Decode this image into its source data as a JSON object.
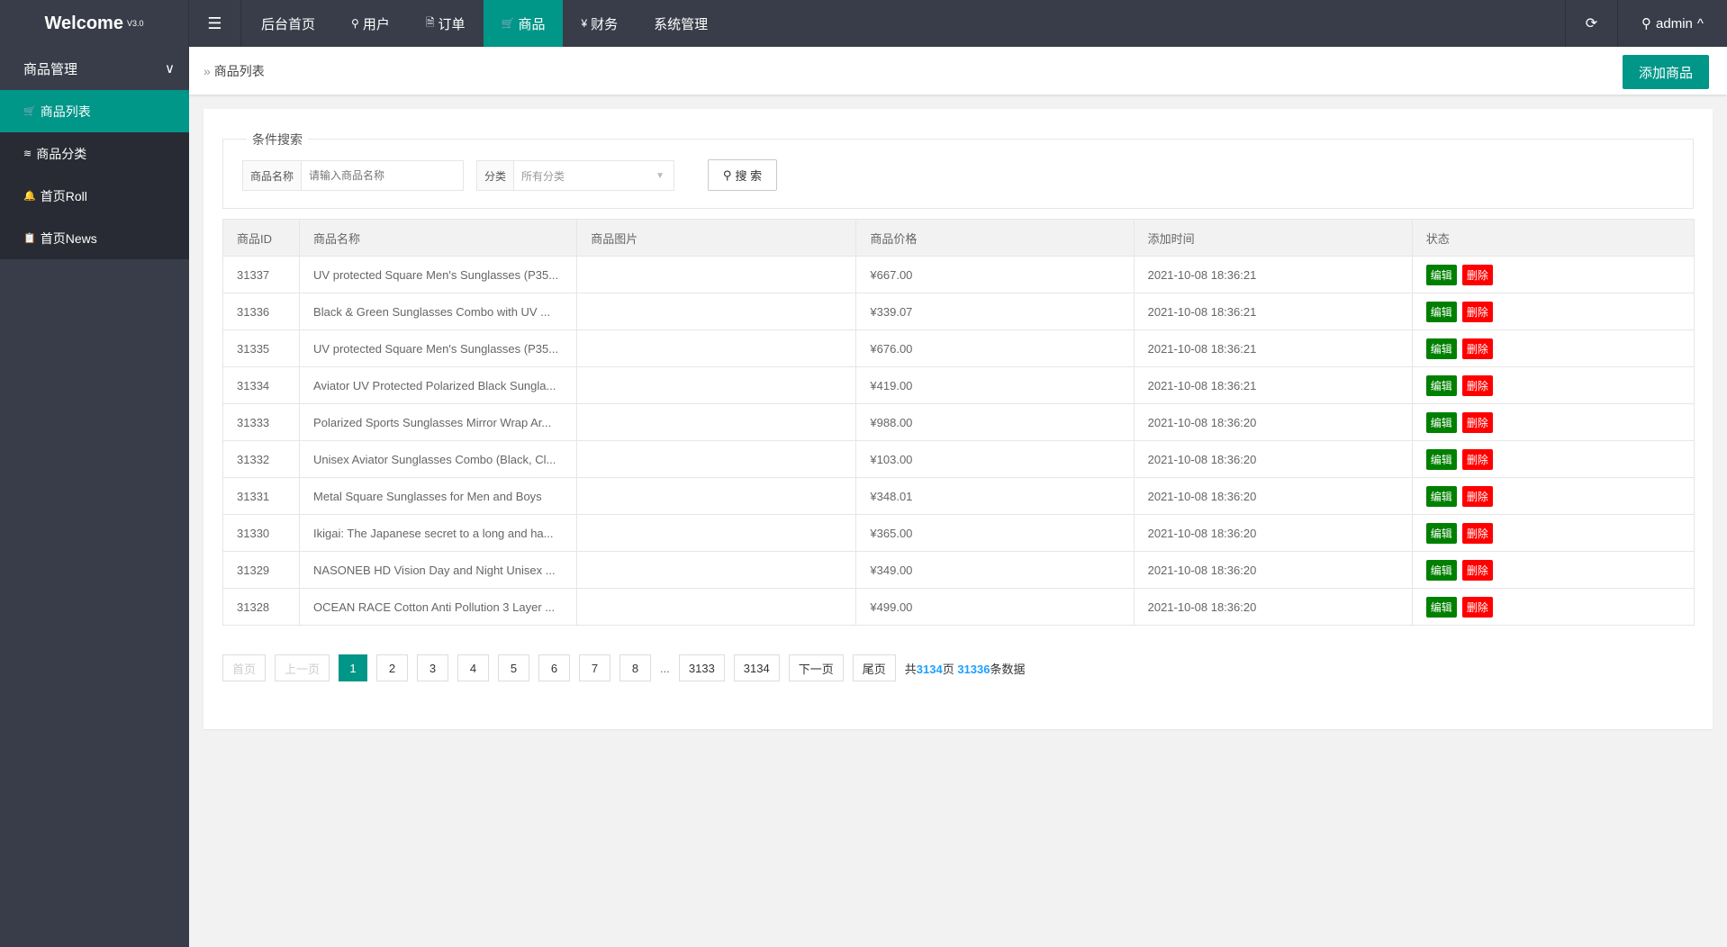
{
  "header": {
    "logo": "Welcome",
    "version": "V3.0",
    "nav": [
      {
        "label": "后台首页",
        "icon": ""
      },
      {
        "label": "用户",
        "icon": "user-icon"
      },
      {
        "label": "订单",
        "icon": "file-icon"
      },
      {
        "label": "商品",
        "icon": "cart-icon",
        "active": true
      },
      {
        "label": "财务",
        "icon": "yen-icon"
      },
      {
        "label": "系统管理",
        "icon": ""
      }
    ],
    "user": "admin"
  },
  "sidebar": {
    "group": "商品管理",
    "items": [
      {
        "label": "商品列表",
        "icon": "cart-icon",
        "active": true
      },
      {
        "label": "商品分类",
        "icon": "layers-icon"
      },
      {
        "label": "首页Roll",
        "icon": "bell-icon"
      },
      {
        "label": "首页News",
        "icon": "clipboard-icon"
      }
    ]
  },
  "breadcrumb": "商品列表",
  "add_button": "添加商品",
  "search": {
    "legend": "条件搜索",
    "name_label": "商品名称",
    "name_placeholder": "请输入商品名称",
    "category_label": "分类",
    "category_value": "所有分类",
    "button": "搜 索"
  },
  "table": {
    "columns": [
      "商品ID",
      "商品名称",
      "商品图片",
      "商品价格",
      "添加时间",
      "状态"
    ],
    "edit_label": "编辑",
    "delete_label": "删除",
    "rows": [
      {
        "id": "31337",
        "name": "UV protected Square Men's Sunglasses (P35...",
        "img": "wrap",
        "price": "¥667.00",
        "time": "2021-10-08 18:36:21"
      },
      {
        "id": "31336",
        "name": "Black & Green Sunglasses Combo with UV ...",
        "img": "wrap",
        "price": "¥339.07",
        "time": "2021-10-08 18:36:21"
      },
      {
        "id": "31335",
        "name": "UV protected Square Men's Sunglasses (P35...",
        "img": "square",
        "price": "¥676.00",
        "time": "2021-10-08 18:36:21"
      },
      {
        "id": "31334",
        "name": "Aviator UV Protected Polarized Black Sungla...",
        "img": "aviator",
        "price": "¥419.00",
        "time": "2021-10-08 18:36:21"
      },
      {
        "id": "31333",
        "name": "Polarized Sports Sunglasses Mirror Wrap Ar...",
        "img": "sport",
        "price": "¥988.00",
        "time": "2021-10-08 18:36:20"
      },
      {
        "id": "31332",
        "name": "Unisex Aviator Sunglasses Combo (Black, Cl...",
        "img": "wire",
        "price": "¥103.00",
        "time": "2021-10-08 18:36:20"
      },
      {
        "id": "31331",
        "name": "Metal Square Sunglasses for Men and Boys",
        "img": "blue",
        "price": "¥348.01",
        "time": "2021-10-08 18:36:20"
      },
      {
        "id": "31330",
        "name": "Ikigai: The Japanese secret to a long and ha...",
        "img": "book",
        "price": "¥365.00",
        "time": "2021-10-08 18:36:20"
      },
      {
        "id": "31329",
        "name": "NASONEB HD Vision Day and Night Unisex ...",
        "img": "square",
        "price": "¥349.00",
        "time": "2021-10-08 18:36:20"
      },
      {
        "id": "31328",
        "name": "OCEAN RACE Cotton Anti Pollution 3 Layer ...",
        "img": "mask",
        "price": "¥499.00",
        "time": "2021-10-08 18:36:20"
      }
    ]
  },
  "pagination": {
    "first": "首页",
    "prev": "上一页",
    "pages": [
      "1",
      "2",
      "3",
      "4",
      "5",
      "6",
      "7",
      "8"
    ],
    "ellipsis": "...",
    "tail": [
      "3133",
      "3134"
    ],
    "next": "下一页",
    "last": "尾页",
    "current": "1",
    "total_prefix": "共",
    "total_pages": "3134",
    "pages_suffix": "页",
    "total_records": "31336",
    "records_suffix": "条数据"
  },
  "colors": {
    "accent": "#009688",
    "topbar": "#393d49",
    "edit": "#008000",
    "delete": "#ff0000",
    "link": "#1e9fff"
  }
}
